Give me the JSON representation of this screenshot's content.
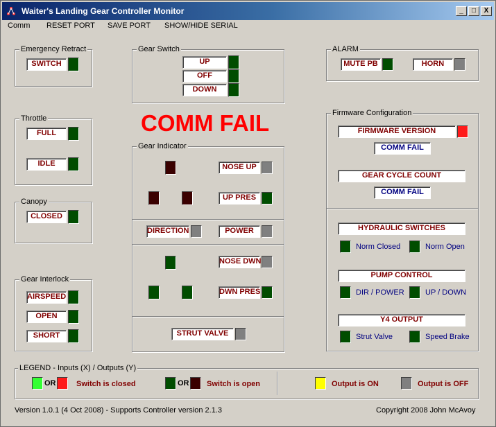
{
  "window": {
    "title": "Waiter's Landing Gear Controller Monitor",
    "controls": {
      "minimize": "_",
      "maximize": "□",
      "close": "X"
    }
  },
  "menu": {
    "items": [
      "Comm",
      "RESET PORT",
      "SAVE PORT",
      "SHOW/HIDE SERIAL"
    ]
  },
  "emergency_retract": {
    "title": "Emergency Retract",
    "switch": "SWITCH"
  },
  "throttle": {
    "title": "Throttle",
    "full": "FULL",
    "idle": "IDLE"
  },
  "canopy": {
    "title": "Canopy",
    "closed": "CLOSED"
  },
  "gear_interlock": {
    "title": "Gear Interlock",
    "airspeed": "AIRSPEED",
    "open": "OPEN",
    "short": "SHORT"
  },
  "gear_switch": {
    "title": "Gear Switch",
    "up": "UP",
    "off": "OFF",
    "down": "DOWN"
  },
  "comm_status": "COMM FAIL",
  "gear_indicator": {
    "title": "Gear Indicator",
    "nose_up": "NOSE UP",
    "up_pres": "UP PRES",
    "direction": "DIRECTION",
    "power": "POWER",
    "nose_dwn": "NOSE DWN",
    "dwn_pres": "DWN PRES",
    "strut_valve": "STRUT VALVE"
  },
  "alarm": {
    "title": "ALARM",
    "mute_pb": "MUTE PB",
    "horn": "HORN"
  },
  "firmware": {
    "title": "Firmware Configuration",
    "version_label": "FIRMWARE VERSION",
    "version_value": "COMM FAIL",
    "gear_cycle_label": "GEAR CYCLE COUNT",
    "gear_cycle_value": "COMM FAIL",
    "hydraulic_switches": "HYDRAULIC SWITCHES",
    "norm_closed": "Norm Closed",
    "norm_open": "Norm Open",
    "pump_control": "PUMP CONTROL",
    "dir_power": "DIR / POWER",
    "up_down": "UP / DOWN",
    "y4_output": "Y4 OUTPUT",
    "strut_valve": "Strut Valve",
    "speed_brake": "Speed Brake"
  },
  "legend": {
    "title": "LEGEND  -  Inputs (X)  / Outputs (Y)",
    "or1": "OR",
    "switch_closed": "Switch is closed",
    "or2": "OR",
    "switch_open": "Switch is open",
    "output_on": "Output is ON",
    "output_off": "Output is OFF"
  },
  "footer": {
    "version": "Version 1.0.1  (4 Oct 2008)  -  Supports Controller version 2.1.3",
    "copyright": "Copyright 2008   John McAvoy"
  },
  "colors": {
    "indicator_off_green": "#004d00",
    "indicator_on_green": "#33ff33",
    "indicator_off_red": "#3a0000",
    "indicator_on_red": "#ff1a1a",
    "output_on": "#ffff00",
    "output_off": "#808080",
    "comm_fail": "#ff0000",
    "label_text": "#800000",
    "value_text": "#000080"
  }
}
